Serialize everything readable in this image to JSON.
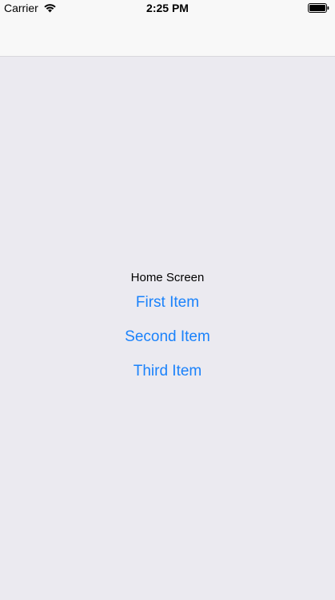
{
  "status_bar": {
    "carrier": "Carrier",
    "time": "2:25 PM",
    "wifi_icon": "wifi-icon",
    "battery_icon": "battery-icon"
  },
  "screen": {
    "title": "Home Screen",
    "items": [
      {
        "label": "First Item"
      },
      {
        "label": "Second Item"
      },
      {
        "label": "Third Item"
      }
    ]
  },
  "colors": {
    "link": "#1a82fb",
    "background": "#ebeaf0",
    "bar": "#f8f8f8"
  }
}
